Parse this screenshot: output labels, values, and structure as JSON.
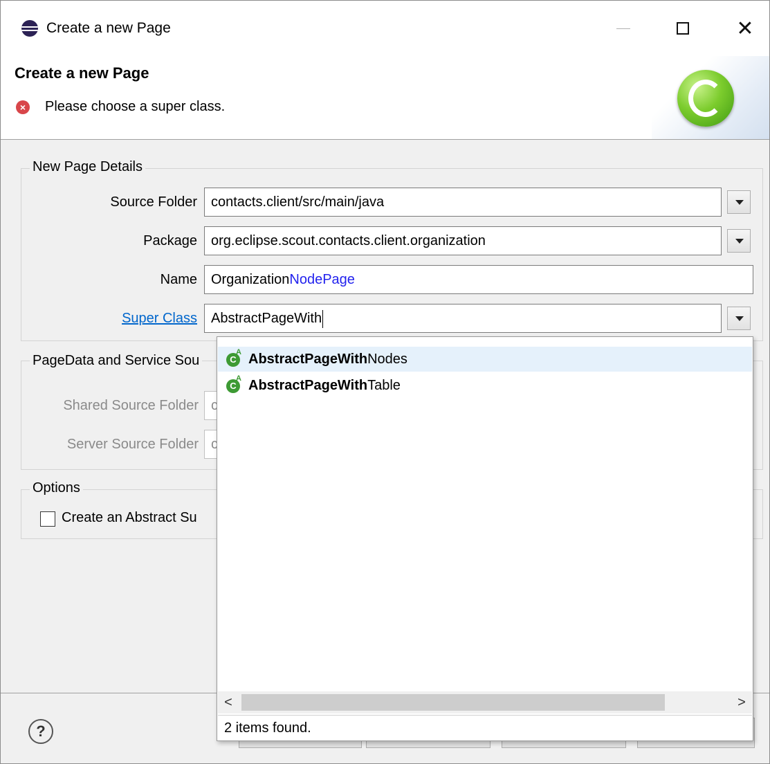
{
  "window": {
    "title": "Create a new Page"
  },
  "banner": {
    "title": "Create a new Page",
    "message": "Please choose a super class."
  },
  "details": {
    "group_label": "New Page Details",
    "source_folder": {
      "label": "Source Folder",
      "value": "contacts.client/src/main/java"
    },
    "package": {
      "label": "Package",
      "value": "org.eclipse.scout.contacts.client.organization"
    },
    "name": {
      "label": "Name",
      "value_prefix": "Organization",
      "value_highlight": "NodePage"
    },
    "super_class": {
      "label": "Super Class",
      "value": "AbstractPageWith"
    }
  },
  "pagedata": {
    "group_label": "PageData and Service Sou",
    "shared_source_folder": {
      "label": "Shared Source Folder",
      "value": "c"
    },
    "server_source_folder": {
      "label": "Server Source Folder",
      "value": "c"
    }
  },
  "options": {
    "group_label": "Options",
    "abstract_super": {
      "label": "Create an Abstract Su",
      "checked": false
    }
  },
  "popup": {
    "items": [
      {
        "match": "AbstractPageWith",
        "rest": "Nodes",
        "selected": true
      },
      {
        "match": "AbstractPageWith",
        "rest": "Table",
        "selected": false
      }
    ],
    "status": "2 items found.",
    "scroll_left": "<",
    "scroll_right": ">"
  },
  "footer": {
    "help": "?"
  },
  "colors": {
    "link": "#0066cc",
    "highlight": "#2222ee",
    "selection": "#e5f1fb",
    "error": "#d8464a"
  },
  "icons": {
    "app": "eclipse-icon",
    "error": "error-icon",
    "logo": "scout-logo-icon",
    "class": "abstract-class-icon",
    "help": "help-icon"
  }
}
